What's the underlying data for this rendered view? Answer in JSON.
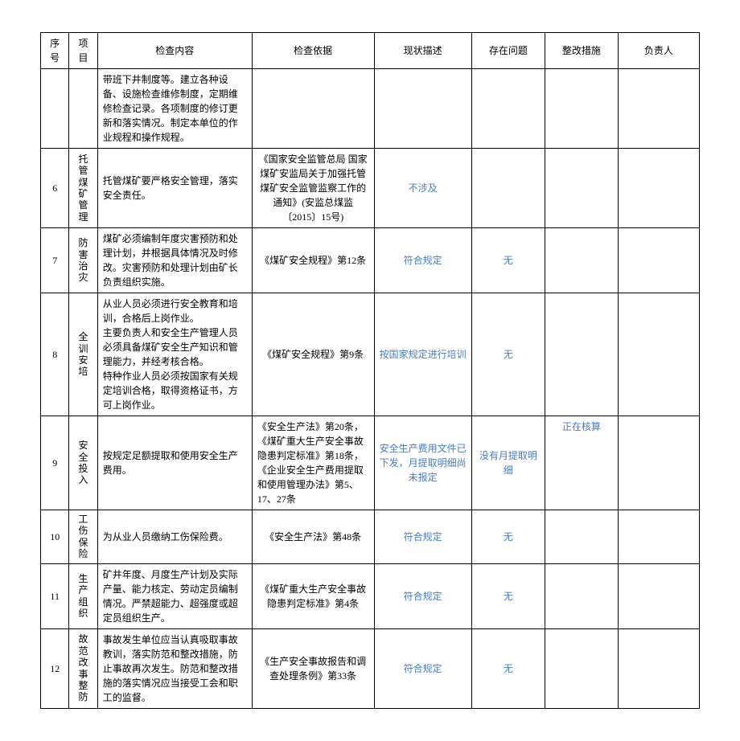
{
  "headers": {
    "seq": "序号",
    "item": "项目",
    "content": "检查内容",
    "basis": "检查依据",
    "status": "现状描述",
    "problem": "存在问题",
    "measure": "整改措施",
    "person": "负责人"
  },
  "rows": [
    {
      "seq": "",
      "item": "",
      "content": "带班下井制度等。建立各种设备、设施检查维修制度，定期维修检查记录。各项制度的修订更新和落实情况。制定本单位的作业规程和操作规程。",
      "basis": "",
      "status": "",
      "problem": "",
      "measure": "",
      "person": ""
    },
    {
      "seq": "6",
      "item": "托管煤矿管理",
      "content": "托管煤矿要严格安全管理，落实安全责任。",
      "basis": "《国家安全监管总局 国家煤矿安监局关于加强托管煤矿安全监管监察工作的通知》(安监总煤监〔2015〕15号)",
      "status": "不涉及",
      "problem": "",
      "measure": "",
      "person": ""
    },
    {
      "seq": "7",
      "item": "防害治灾",
      "content": "煤矿必须编制年度灾害预防和处理计划，并根据具体情况及时修改。灾害预防和处理计划由矿长负责组织实施。",
      "basis": "《煤矿安全规程》第12条",
      "status": "符合规定",
      "problem": "无",
      "measure": "",
      "person": ""
    },
    {
      "seq": "8",
      "item": "全训安培",
      "content": "从业人员必须进行安全教育和培训，合格后上岗作业。\n主要负责人和安全生产管理人员必须具备煤矿安全生产知识和管理能力，并经考核合格。\n特种作业人员必须按国家有关规定培训合格，取得资格证书，方可上岗作业。",
      "basis": "《煤矿安全规程》第9条",
      "status": "按国家规定进行培训",
      "problem": "无",
      "measure": "",
      "person": ""
    },
    {
      "seq": "9",
      "item": "安全投入",
      "content": "按规定足额提取和使用安全生产费用。",
      "basis": "《安全生产法》第20条，《煤矿重大生产安全事故隐患判定标准》第18条，《企业安全生产费用提取和使用管理办法》第5、17、27条",
      "status": "安全生产费用文件已下发，月提取明细尚未报定",
      "problem": "没有月提取明细",
      "measure": "正在核算",
      "person": ""
    },
    {
      "seq": "10",
      "item": "工伤保险",
      "content": "为从业人员缴纳工伤保险费。",
      "basis": "《安全生产法》第48条",
      "status": "符合规定",
      "problem": "无",
      "measure": "",
      "person": ""
    },
    {
      "seq": "11",
      "item": "生产组织",
      "content": "矿井年度、月度生产计划及实际产量、能力核定、劳动定员编制情况。严禁超能力、超强度或超定员组织生产。",
      "basis": "《煤矿重大生产安全事故隐患判定标准》第4条",
      "status": "符合规定",
      "problem": "无",
      "measure": "",
      "person": ""
    },
    {
      "seq": "12",
      "item": "故范改事整防",
      "content": "事故发生单位应当认真吸取事故教训，落实防范和整改措施，防止事故再次发生。防范和整改措施的落实情况应当接受工会和职工的监督。",
      "basis": "《生产安全事故报告和调查处理条例》第33条",
      "status": "符合规定",
      "problem": "无",
      "measure": "",
      "person": ""
    }
  ]
}
